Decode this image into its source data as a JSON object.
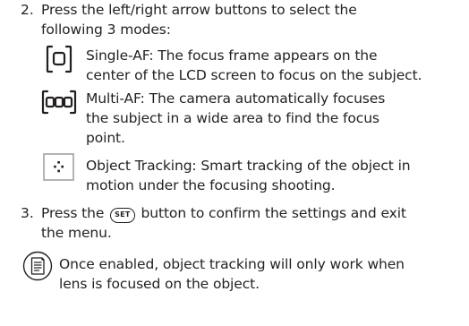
{
  "steps": [
    {
      "number": "2.",
      "text_line1": "Press the left/right arrow buttons to select the",
      "text_line2": "following 3 modes:",
      "modes": [
        {
          "icon": "single-af-icon",
          "line1": "Single-AF: The focus frame appears on the",
          "line2": "center of the LCD screen to focus on the subject."
        },
        {
          "icon": "multi-af-icon",
          "line1": "Multi-AF: The camera automatically focuses",
          "line2": "the subject in a wide area to find the focus",
          "line3": "point."
        },
        {
          "icon": "object-tracking-icon",
          "line1": "Object Tracking: Smart tracking of the object in",
          "line2": "motion under the focusing shooting."
        }
      ]
    },
    {
      "number": "3.",
      "text_before": "Press the",
      "button_label": "SET",
      "text_after": "button to confirm the settings and exit",
      "text_line2": "the menu."
    }
  ],
  "note": {
    "icon": "note-icon",
    "line1": "Once enabled, object tracking will only work when",
    "line2": "lens is focused on the object."
  }
}
